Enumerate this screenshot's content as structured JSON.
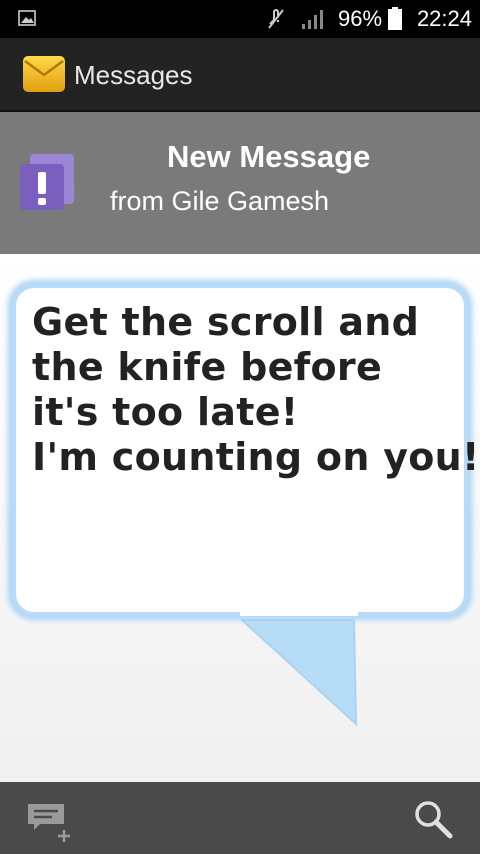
{
  "status_bar": {
    "battery": "96%",
    "time": "22:24"
  },
  "app_bar": {
    "title": "Messages"
  },
  "notification": {
    "title": "New Message",
    "subtitle": "from Gile Gamesh"
  },
  "message": {
    "lines": [
      "Get the scroll and",
      "the knife before",
      "it's too late!",
      "I'm counting on you!"
    ]
  },
  "icons": {
    "status_left": "picture-icon",
    "mute": "mute-icon",
    "signal": "signal-icon",
    "battery": "battery-icon",
    "app": "envelope-icon",
    "notification": "alert-chat-icon",
    "compose": "new-message-icon",
    "search": "search-icon"
  },
  "colors": {
    "accent_purple": "#7a5fbf",
    "bubble_border": "#aed4f5",
    "envelope": "#f0b820"
  }
}
